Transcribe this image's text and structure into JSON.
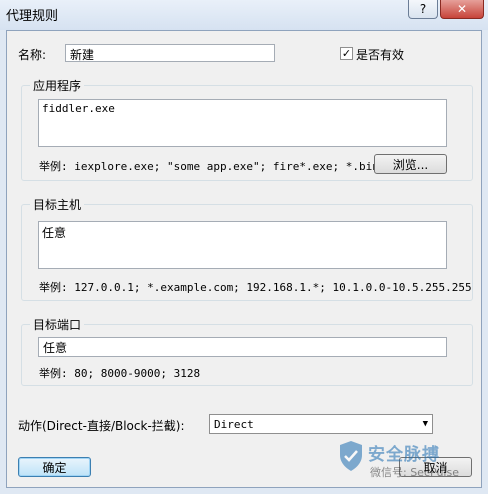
{
  "window": {
    "title": "代理规则"
  },
  "caption": {
    "help_glyph": "?",
    "close_glyph": "✕"
  },
  "name": {
    "label": "名称:",
    "value": "新建"
  },
  "enabled": {
    "label": "是否有效",
    "checked": true,
    "check_glyph": "✓"
  },
  "applications": {
    "group_title": "应用程序",
    "value": "fiddler.exe",
    "example": "举例: iexplore.exe; \"some app.exe\"; fire*.exe; *.bin",
    "browse_label": "浏览..."
  },
  "target_host": {
    "group_title": "目标主机",
    "value": "任意",
    "example": "举例: 127.0.0.1; *.example.com; 192.168.1.*; 10.1.0.0-10.5.255.255"
  },
  "target_port": {
    "group_title": "目标端口",
    "value": "任意",
    "example": "举例: 80; 8000-9000; 3128"
  },
  "action": {
    "label": "动作(Direct-直接/Block-拦截):",
    "selected": "Direct",
    "arrow_glyph": "▼"
  },
  "buttons": {
    "ok_label": "确定",
    "cancel_label": "取消"
  },
  "watermark": {
    "line1": "安全脉搏",
    "line2": "微信号: SecPulse"
  }
}
